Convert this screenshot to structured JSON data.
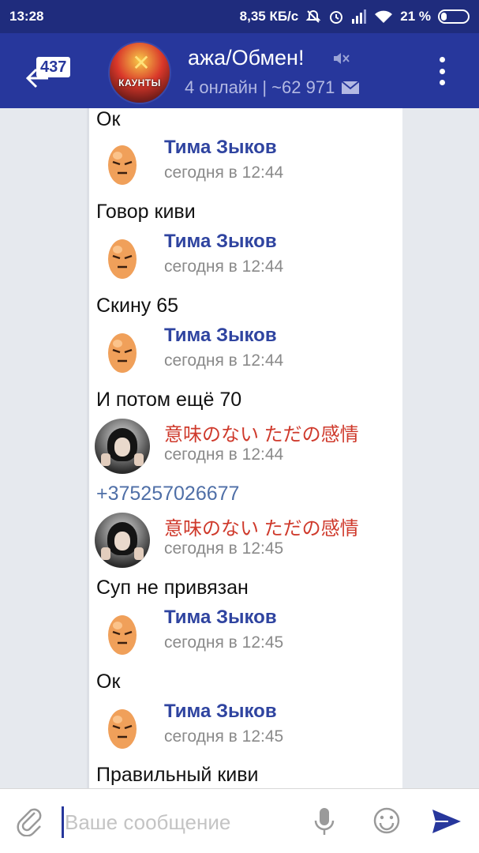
{
  "status_bar": {
    "time": "13:28",
    "network_speed": "8,35 КБ/с",
    "battery": "21 %",
    "icons": [
      "alarm-off-icon",
      "alarm-clock-icon",
      "signal-icon",
      "wifi-icon",
      "battery-icon"
    ]
  },
  "app_bar": {
    "back_icon": "back-arrow-icon",
    "unread_count": "437",
    "title": "ажа/Обмен!",
    "subtitle": "4 онлайн | ~62 971",
    "avatar_text": "КАУНТЫ",
    "icons": [
      "mute-icon",
      "mail-icon",
      "more-vert-icon"
    ]
  },
  "messages": [
    {
      "type": "text",
      "text": "Ок"
    },
    {
      "type": "header",
      "avatar": "egg",
      "sender": "Тима Зыков",
      "time": "сегодня в 12:44"
    },
    {
      "type": "text",
      "text": "Говор киви"
    },
    {
      "type": "header",
      "avatar": "egg",
      "sender": "Тима Зыков",
      "time": "сегодня в 12:44"
    },
    {
      "type": "text",
      "text": "Скину 65"
    },
    {
      "type": "header",
      "avatar": "egg",
      "sender": "Тима Зыков",
      "time": "сегодня в 12:44"
    },
    {
      "type": "text",
      "text": "И потом ещё 70"
    },
    {
      "type": "header",
      "avatar": "photo",
      "sender": "意味のない ただの感情",
      "time": "сегодня в 12:44"
    },
    {
      "type": "text",
      "text": "+375257026677",
      "style": "phone"
    },
    {
      "type": "header",
      "avatar": "photo",
      "sender": "意味のない ただの感情",
      "time": "сегодня в 12:45"
    },
    {
      "type": "text",
      "text": "Суп не привязан"
    },
    {
      "type": "header",
      "avatar": "egg",
      "sender": "Тима Зыков",
      "time": "сегодня в 12:45"
    },
    {
      "type": "text",
      "text": "Ок"
    },
    {
      "type": "header",
      "avatar": "egg",
      "sender": "Тима Зыков",
      "time": "сегодня в 12:45"
    },
    {
      "type": "text",
      "text": "Правильный киви"
    }
  ],
  "input": {
    "placeholder": "Ваше сообщение",
    "value": "",
    "icons": [
      "attach-icon",
      "mic-icon",
      "emoji-icon",
      "send-icon"
    ]
  },
  "colors": {
    "status_bar": "#1f2c7d",
    "app_bar": "#27379c",
    "sender_blue": "#2f44a0",
    "sender_red": "#cf3a2c",
    "phone_link": "#4f6fa7"
  }
}
